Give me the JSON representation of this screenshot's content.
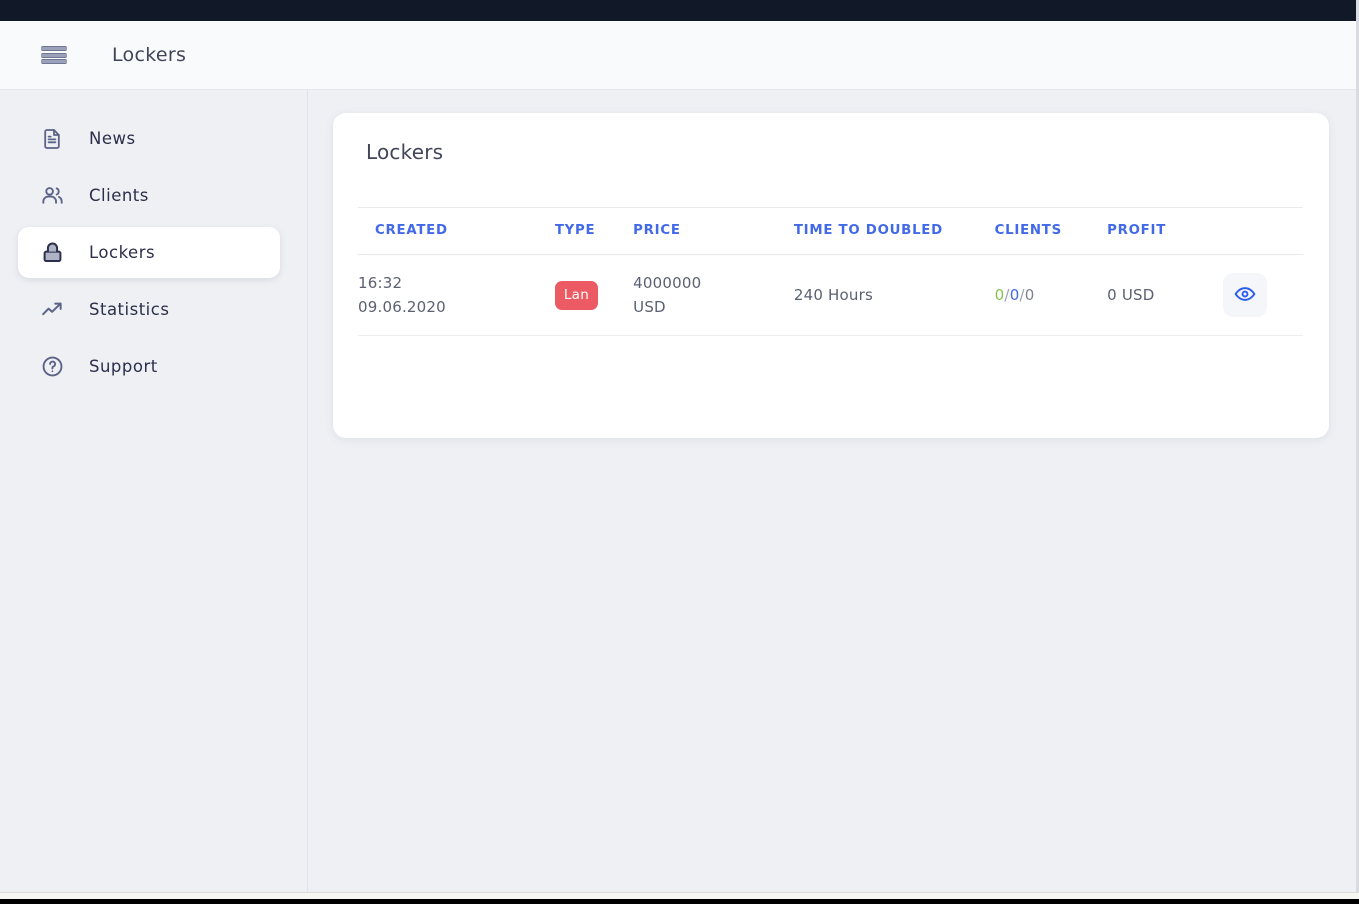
{
  "window": {
    "os_bar_color": "#111827"
  },
  "header": {
    "menu_icon": "hamburger-icon",
    "title": "Lockers"
  },
  "sidebar": {
    "items": [
      {
        "id": "news",
        "label": "News",
        "icon": "document-icon",
        "active": false
      },
      {
        "id": "clients",
        "label": "Clients",
        "icon": "users-icon",
        "active": false
      },
      {
        "id": "lockers",
        "label": "Lockers",
        "icon": "lock-icon",
        "active": true
      },
      {
        "id": "statistics",
        "label": "Statistics",
        "icon": "trending-up-icon",
        "active": false
      },
      {
        "id": "support",
        "label": "Support",
        "icon": "help-circle-icon",
        "active": false
      }
    ]
  },
  "main": {
    "card_title": "Lockers",
    "table": {
      "columns": [
        {
          "key": "created",
          "label": "CREATED"
        },
        {
          "key": "type",
          "label": "TYPE"
        },
        {
          "key": "price",
          "label": "PRICE"
        },
        {
          "key": "ttd",
          "label": "TIME TO DOUBLED"
        },
        {
          "key": "clients",
          "label": "CLIENTS"
        },
        {
          "key": "profit",
          "label": "PROFIT"
        },
        {
          "key": "actions",
          "label": ""
        }
      ],
      "rows": [
        {
          "created_time": "16:32",
          "created_date": "09.06.2020",
          "type_badge": "Lan",
          "type_badge_color": "#ec5a63",
          "price_amount": "4000000",
          "price_currency": "USD",
          "time_to_doubled": "240 Hours",
          "clients_online": "0",
          "clients_total": "0",
          "clients_other": "0",
          "clients_separator": "/",
          "profit": "0 USD",
          "action_icon": "eye-icon"
        }
      ]
    }
  },
  "colors": {
    "accent_blue": "#4169e8",
    "badge_red": "#ec5a63",
    "clients_green": "#86c34f",
    "text_dark": "#2b2f4a",
    "page_bg": "#eef0f4"
  }
}
